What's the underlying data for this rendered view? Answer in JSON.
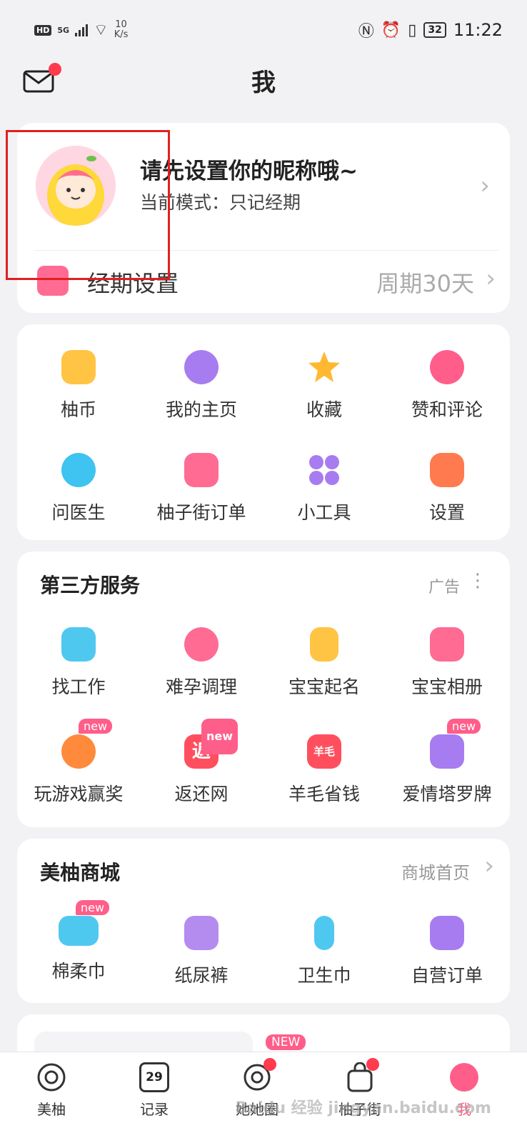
{
  "status_bar": {
    "hd": "HD",
    "signal": "5G",
    "speed_value": "10",
    "speed_unit": "K/s",
    "battery": "32",
    "time": "11:22"
  },
  "header": {
    "title": "我"
  },
  "profile": {
    "nickname": "请先设置你的昵称哦~",
    "mode": "当前模式：只记经期",
    "period_label": "经期设置",
    "period_value": "周期30天"
  },
  "quick_menu": [
    {
      "label": "柚币",
      "icon": "coin-icon"
    },
    {
      "label": "我的主页",
      "icon": "profile-icon"
    },
    {
      "label": "收藏",
      "icon": "star-icon"
    },
    {
      "label": "赞和评论",
      "icon": "thumbs-up-icon"
    },
    {
      "label": "问医生",
      "icon": "doctor-icon"
    },
    {
      "label": "柚子街订单",
      "icon": "order-icon"
    },
    {
      "label": "小工具",
      "icon": "tools-icon"
    },
    {
      "label": "设置",
      "icon": "settings-icon"
    }
  ],
  "third_party": {
    "title": "第三方服务",
    "ad_label": "广告",
    "items": [
      {
        "label": "找工作",
        "icon": "briefcase-icon"
      },
      {
        "label": "难孕调理",
        "icon": "care-icon"
      },
      {
        "label": "宝宝起名",
        "icon": "name-icon"
      },
      {
        "label": "宝宝相册",
        "icon": "album-icon"
      },
      {
        "label": "玩游戏赢奖",
        "icon": "game-icon",
        "badge": "new"
      },
      {
        "label": "返还网",
        "icon": "rebate-icon",
        "badge": "new",
        "glyph": "返"
      },
      {
        "label": "羊毛省钱",
        "icon": "savings-icon",
        "glyph": "羊毛"
      },
      {
        "label": "爱情塔罗牌",
        "icon": "tarot-icon",
        "badge": "new"
      }
    ]
  },
  "mall": {
    "title": "美柚商城",
    "link": "商城首页",
    "items": [
      {
        "label": "棉柔巾",
        "icon": "cotton-towel-icon",
        "badge": "new"
      },
      {
        "label": "纸尿裤",
        "icon": "diaper-icon"
      },
      {
        "label": "卫生巾",
        "icon": "pad-icon"
      },
      {
        "label": "自营订单",
        "icon": "self-order-icon"
      }
    ]
  },
  "promo": {
    "badge": "NEW"
  },
  "tabs": [
    {
      "label": "美柚",
      "icon": "home-icon"
    },
    {
      "label": "记录",
      "icon": "calendar-icon",
      "glyph": "29"
    },
    {
      "label": "她她圈",
      "icon": "community-icon"
    },
    {
      "label": "柚子街",
      "icon": "shop-bag-icon"
    },
    {
      "label": "我",
      "icon": "me-icon"
    }
  ],
  "watermark": "Baidu 经验 jingyan.baidu.com",
  "colors": {
    "accent": "#ff5e8a",
    "notification": "#ff3b4d",
    "highlight_box": "#e02020"
  }
}
